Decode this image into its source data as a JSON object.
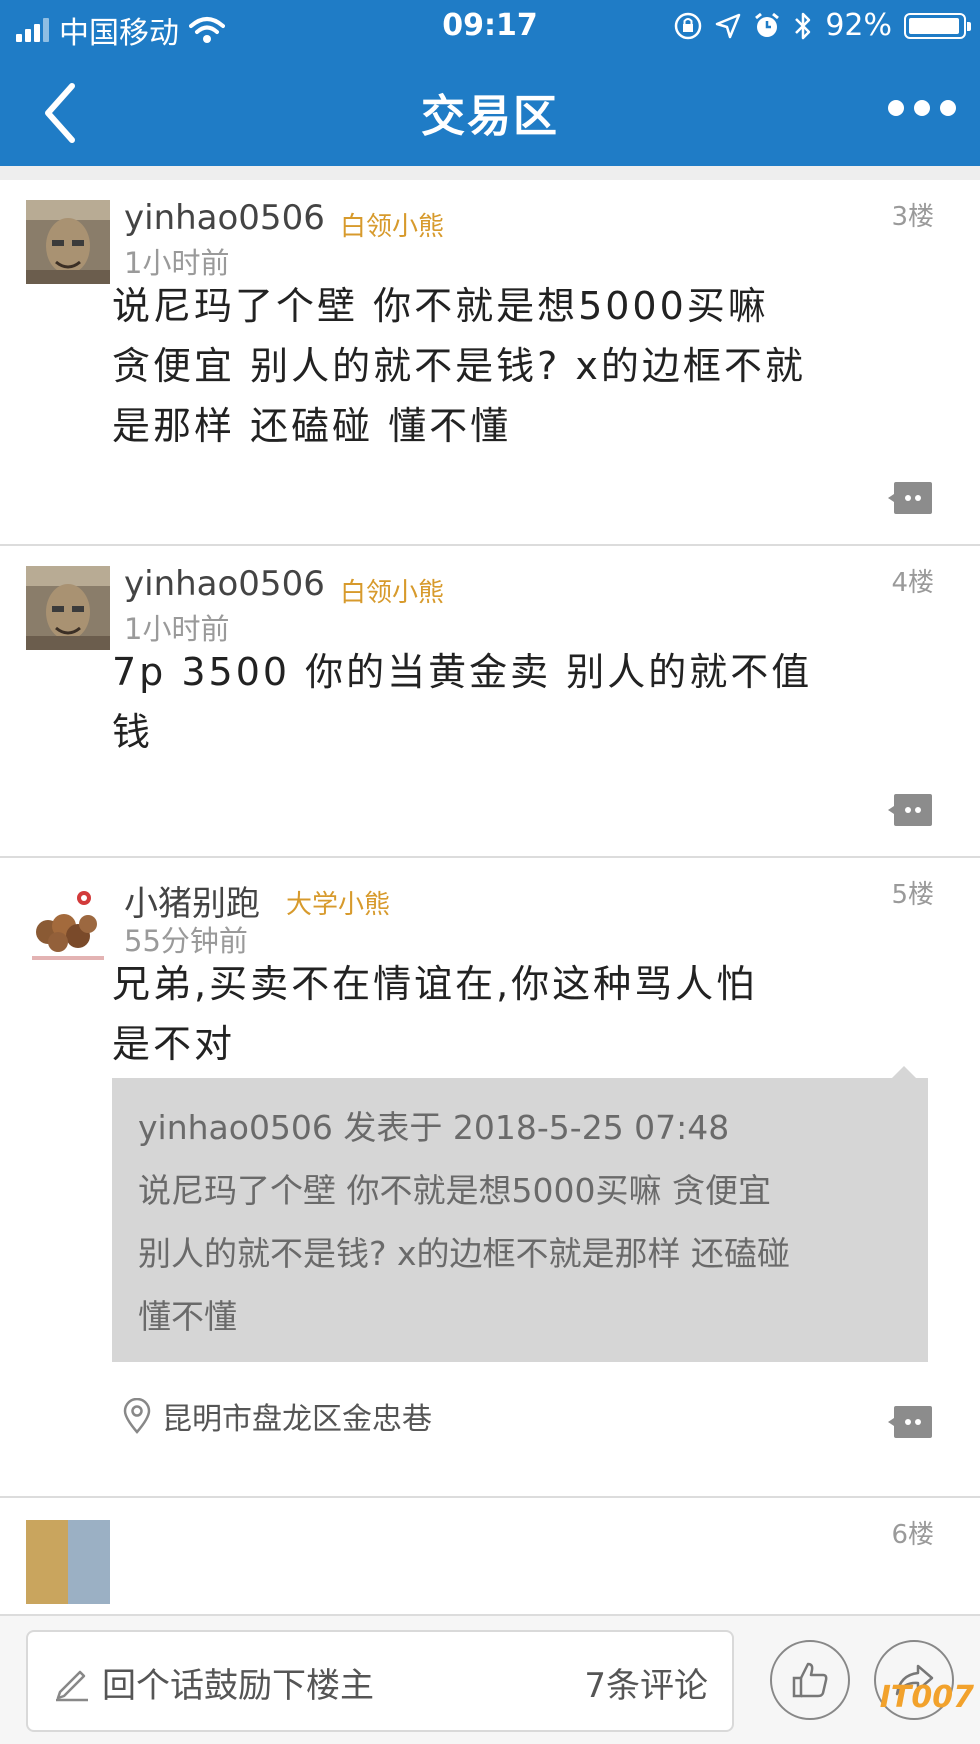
{
  "status_bar": {
    "carrier": "中国移动",
    "time": "09:17",
    "battery": "92%"
  },
  "navbar": {
    "title": "交易区"
  },
  "posts": [
    {
      "author": "yinhao0506",
      "badge": "白领小熊",
      "time": "1小时前",
      "floor": "3楼",
      "lines": [
        "说尼玛了个壁    你不就是想5000买嘛",
        "贪便宜 别人的就不是钱?   x的边框不就",
        "是那样 还磕碰  懂不懂"
      ]
    },
    {
      "author": "yinhao0506",
      "badge": "白领小熊",
      "time": "1小时前",
      "floor": "4楼",
      "lines": [
        "7p  3500  你的当黄金卖 别人的就不值",
        "钱"
      ]
    },
    {
      "author": "小猪别跑",
      "badge": "大学小熊",
      "time": "55分钟前",
      "floor": "5楼",
      "lines": [
        "兄弟,买卖不在情谊在,你这种骂人怕",
        "是不对"
      ],
      "quote": [
        "yinhao0506 发表于 2018-5-25 07:48",
        "说尼玛了个壁    你不就是想5000买嘛  贪便宜",
        "别人的就不是钱?   x的边框不就是那样 还磕碰",
        "懂不懂"
      ],
      "location": "昆明市盘龙区金忠巷"
    },
    {
      "floor": "6楼"
    }
  ],
  "bottom_bar": {
    "placeholder": "回个话鼓励下楼主",
    "comment_count": "7条评论",
    "watermark": "IT007"
  },
  "colors": {
    "nav_blue": "#1f7cc6",
    "badge_gold": "#d79a2c",
    "quote_bg": "#d6d6d6"
  },
  "icons": [
    "signal-icon",
    "wifi-icon",
    "lock-rotation-icon",
    "location-arrow-icon",
    "alarm-icon",
    "bluetooth-icon",
    "battery-icon",
    "back-icon",
    "more-icon",
    "reply-bubble-icon",
    "location-pin-icon",
    "pencil-icon",
    "thumbs-up-icon",
    "share-icon"
  ]
}
